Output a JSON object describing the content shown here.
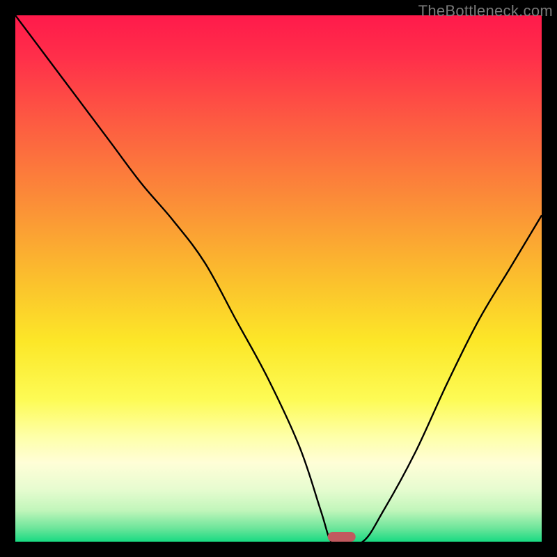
{
  "watermark": "TheBottleneck.com",
  "chart_data": {
    "type": "line",
    "title": "",
    "xlabel": "",
    "ylabel": "",
    "xlim": [
      0,
      100
    ],
    "ylim": [
      0,
      100
    ],
    "optimal_marker": {
      "x": 62,
      "color": "#c1595f"
    },
    "gradient_stops": [
      {
        "offset": 0.0,
        "color": "#ff1a4b"
      },
      {
        "offset": 0.08,
        "color": "#ff2f4a"
      },
      {
        "offset": 0.2,
        "color": "#fd5a42"
      },
      {
        "offset": 0.35,
        "color": "#fb8c38"
      },
      {
        "offset": 0.5,
        "color": "#fbbf2d"
      },
      {
        "offset": 0.62,
        "color": "#fce728"
      },
      {
        "offset": 0.73,
        "color": "#fdfb55"
      },
      {
        "offset": 0.8,
        "color": "#feffa8"
      },
      {
        "offset": 0.85,
        "color": "#fffed7"
      },
      {
        "offset": 0.9,
        "color": "#e7fcd0"
      },
      {
        "offset": 0.94,
        "color": "#c2f6bb"
      },
      {
        "offset": 0.975,
        "color": "#6be59a"
      },
      {
        "offset": 1.0,
        "color": "#18da82"
      }
    ],
    "series": [
      {
        "name": "bottleneck-curve",
        "x": [
          0,
          6,
          12,
          18,
          24,
          30,
          36,
          42,
          48,
          54,
          58,
          60,
          62,
          66,
          70,
          76,
          82,
          88,
          94,
          100
        ],
        "y": [
          100,
          92,
          84,
          76,
          68,
          61,
          53,
          42,
          31,
          18,
          6,
          0,
          0,
          0,
          6,
          17,
          30,
          42,
          52,
          62
        ]
      }
    ]
  }
}
